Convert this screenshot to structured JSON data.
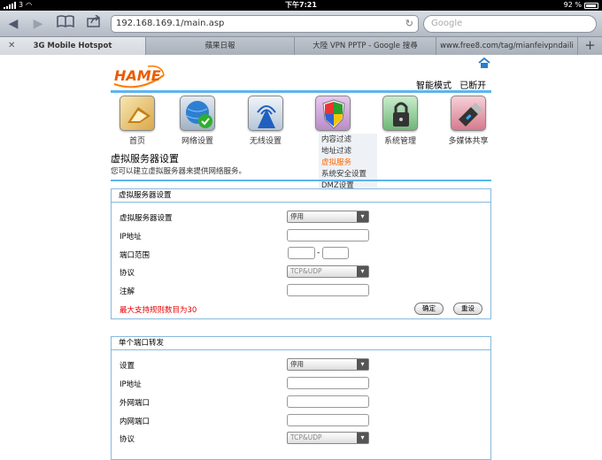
{
  "statusbar": {
    "carrier": "3",
    "time": "下午7:21",
    "battery": "92 %"
  },
  "browser": {
    "url": "192.168.169.1/main.asp",
    "search_placeholder": "Google",
    "tabs": [
      {
        "label": "3G Mobile Hotspot",
        "active": true
      },
      {
        "label": "蘋果日報",
        "active": false
      },
      {
        "label": "大陸 VPN PPTP - Google 搜尋",
        "active": false
      },
      {
        "label": "www.free8.com/tag/mianfeivpndaili",
        "active": false
      }
    ],
    "new_tab_label": "+"
  },
  "header": {
    "logo_text": "HAME",
    "mode": "智能模式",
    "connection": "已断开"
  },
  "nav": {
    "items": [
      {
        "label": "首页"
      },
      {
        "label": "网络设置"
      },
      {
        "label": "无线设置"
      },
      {
        "label": ""
      },
      {
        "label": "系统管理"
      },
      {
        "label": "多媒体共享"
      }
    ],
    "submenu": [
      {
        "label": "内容过滤"
      },
      {
        "label": "地址过滤"
      },
      {
        "label": "虚拟服务",
        "active": true
      },
      {
        "label": "系统安全设置"
      },
      {
        "label": "DMZ设置"
      }
    ]
  },
  "page": {
    "title": "虚拟服务器设置",
    "description": "您可以建立虚拟服务器来提供网络服务。"
  },
  "virtual_server": {
    "heading": "虚拟服务器设置",
    "rows": {
      "server_label": "虚拟服务器设置",
      "server_value": "停用",
      "ip_label": "IP地址",
      "port_range_label": "端口范围",
      "port_dash": "-",
      "protocol_label": "协议",
      "protocol_value": "TCP&UDP",
      "note_label": "注解"
    },
    "warning": "最大支持规则数目为30",
    "ok_button": "确定",
    "reset_button": "重设"
  },
  "single_port": {
    "heading": "单个端口转发",
    "rows": {
      "setting_label": "设置",
      "setting_value": "停用",
      "ip_label": "IP地址",
      "external_port_label": "外网端口",
      "internal_port_label": "内网端口",
      "protocol_label": "协议",
      "protocol_value": "TCP&UDP"
    }
  }
}
